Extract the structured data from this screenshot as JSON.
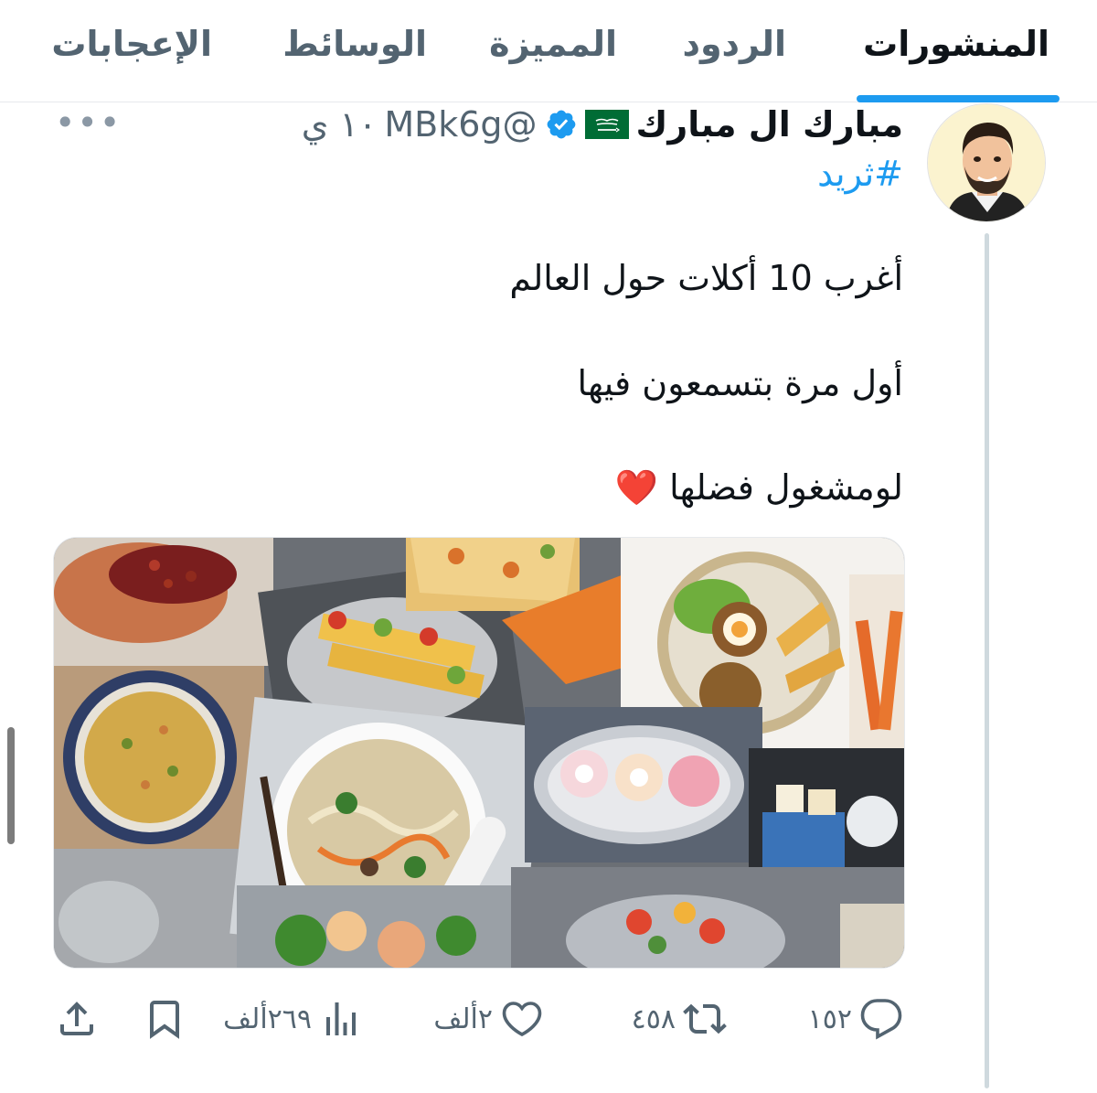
{
  "tabs": [
    {
      "label": "المنشورات",
      "active": true
    },
    {
      "label": "الردود",
      "active": false
    },
    {
      "label": "المميزة",
      "active": false
    },
    {
      "label": "الوسائط",
      "active": false
    },
    {
      "label": "الإعجابات",
      "active": false
    }
  ],
  "post": {
    "display_name": "مبارك ال مبارك",
    "flag_icon": "saudi-flag-icon",
    "verified_icon": "verified-badge-icon",
    "handle": "@MBk6g",
    "time": "١٠ ي",
    "hashtag": "#ثريد",
    "lines": [
      "أغرب 10 أكلات حول العالم",
      "أول مرة بتسمعون فيها",
      "لومشغول فضلها ❤️"
    ],
    "more_icon": "more-icon",
    "media_alt": "food-collage-image"
  },
  "actions": {
    "replies": "١٥٢",
    "reposts": "٤٥٨",
    "likes": "٢ألف",
    "views": "٢٦٩ألف"
  },
  "colors": {
    "accent": "#1d9bf0",
    "text": "#0f1419",
    "secondary": "#536471"
  }
}
